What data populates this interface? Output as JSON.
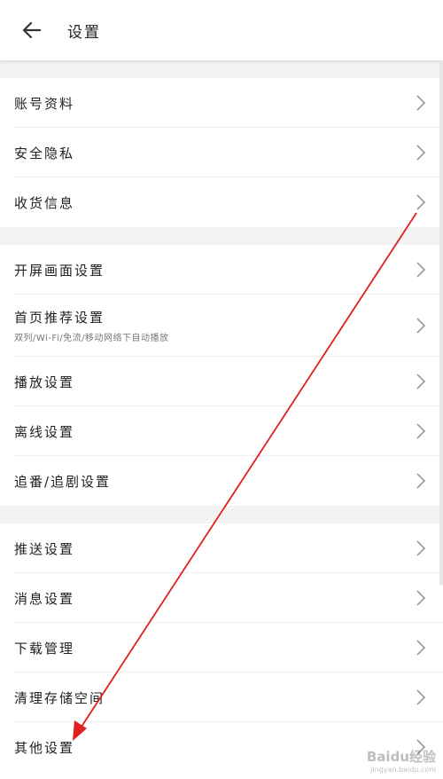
{
  "header": {
    "back_icon": "arrow-left-icon",
    "title": "设置"
  },
  "sections": [
    {
      "items": [
        {
          "label": "账号资料"
        },
        {
          "label": "安全隐私"
        },
        {
          "label": "收货信息"
        }
      ]
    },
    {
      "items": [
        {
          "label": "开屏画面设置"
        },
        {
          "label": "首页推荐设置",
          "sub": "双列/Wi-Fi/免流/移动网络下自动播放"
        },
        {
          "label": "播放设置"
        },
        {
          "label": "离线设置"
        },
        {
          "label": "追番/追剧设置"
        }
      ]
    },
    {
      "items": [
        {
          "label": "推送设置"
        },
        {
          "label": "消息设置"
        },
        {
          "label": "下载管理"
        },
        {
          "label": "清理存储空间"
        },
        {
          "label": "其他设置"
        }
      ]
    }
  ],
  "annotation": {
    "arrow_color": "#e02020",
    "icon": "red-arrow-annotation"
  },
  "watermark": {
    "brand": "Baidu经验",
    "url": "jingyan.baidu.com"
  },
  "colors": {
    "section_gap": "#f3f3f3",
    "divider": "#ececec",
    "chevron": "#9a9a9a"
  }
}
